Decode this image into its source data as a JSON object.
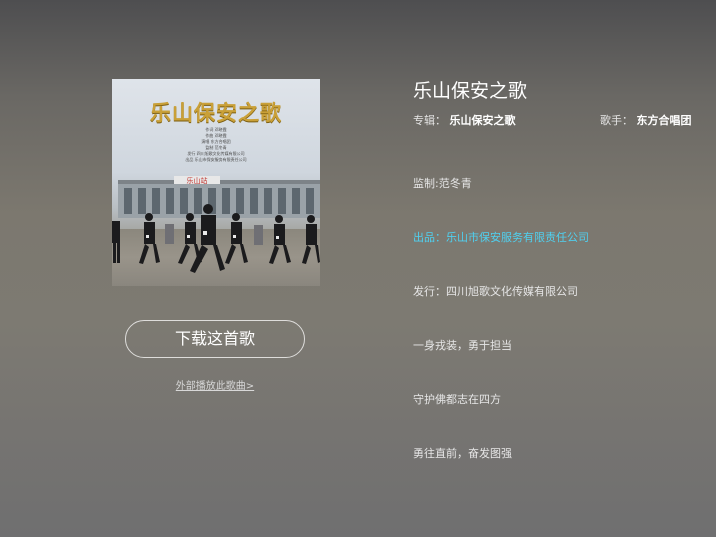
{
  "cover": {
    "title": "乐山保安之歌",
    "credits": [
      "作词  邓晓霞",
      "作曲  邓晓霞",
      "演唱  东方合唱团",
      "监制 范冬青",
      "发行  四川旭歌文化传媒有限公司",
      "出品  乐山市保安服务有限责任公司"
    ],
    "sign_text": "乐山站"
  },
  "download_button_label": "下载这首歌",
  "external_link_label": "外部播放此歌曲>",
  "song": {
    "title": "乐山保安之歌",
    "album_label": "专辑：",
    "album_value": "乐山保安之歌",
    "singer_label": "歌手：",
    "singer_value": "东方合唱团"
  },
  "info_lines": [
    "监制:范冬青",
    "出品：乐山市保安服务有限责任公司",
    "发行：四川旭歌文化传媒有限公司",
    "一身戎装，勇于担当",
    "守护佛都志在四方",
    "勇往直前，奋发图强"
  ],
  "colors": {
    "highlight": "#4fd0f0",
    "cover_title_gold": "#c9a038"
  }
}
